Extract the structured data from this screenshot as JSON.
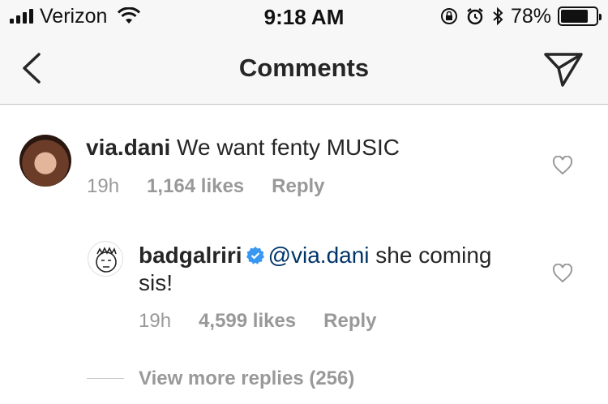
{
  "status_bar": {
    "carrier": "Verizon",
    "time": "9:18 AM",
    "battery_percent": "78%",
    "battery_level": 0.78
  },
  "nav": {
    "title": "Comments"
  },
  "comments": [
    {
      "username": "via.dani",
      "text": "We want fenty MUSIC",
      "time": "19h",
      "likes": "1,164 likes",
      "reply": "Reply"
    },
    {
      "username": "badgalriri",
      "verified": true,
      "mention": "@via.dani",
      "text": " she coming sis!",
      "time": "19h",
      "likes": "4,599 likes",
      "reply": "Reply"
    }
  ],
  "view_more_replies": "View more replies (256)",
  "colors": {
    "mention": "#003569",
    "meta": "#999999",
    "verified": "#3897f0"
  }
}
